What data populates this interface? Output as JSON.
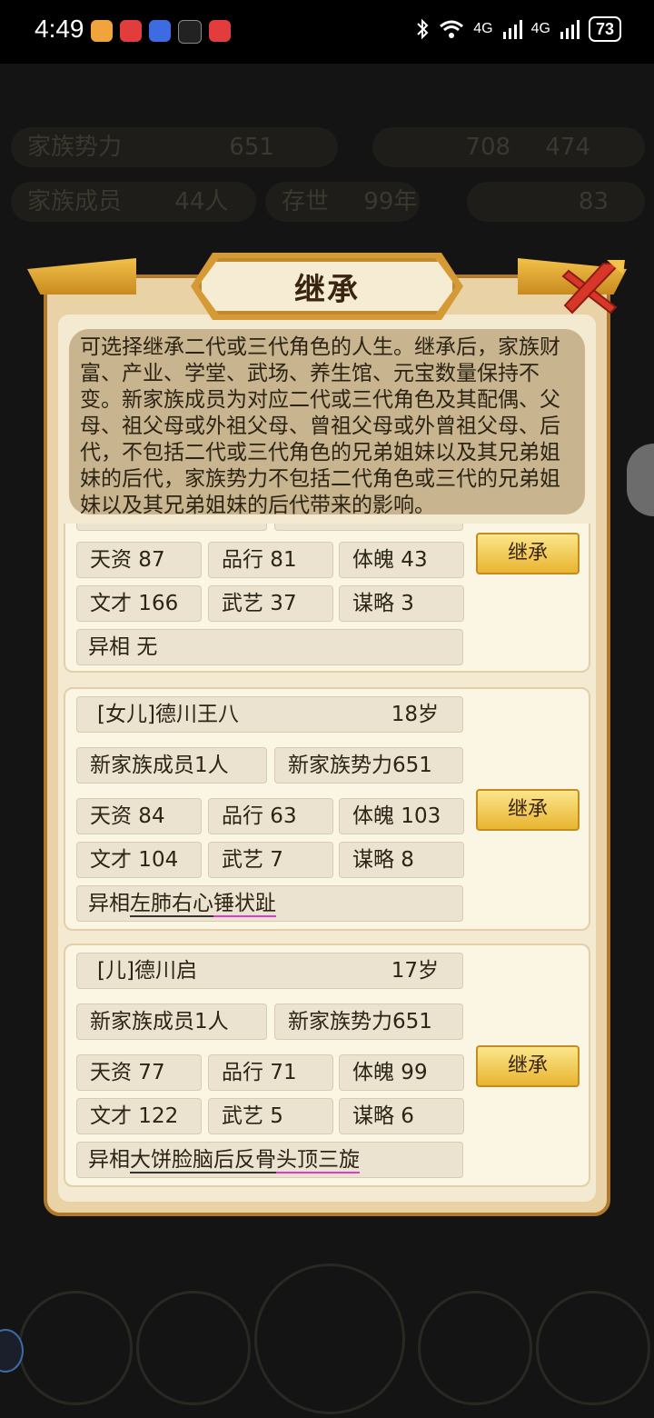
{
  "status_bar": {
    "time": "4:49",
    "battery": "73",
    "network_left": "4G",
    "network_right": "4G"
  },
  "modal": {
    "title": "继承",
    "description": "可选择继承二代或三代角色的人生。继承后，家族财富、产业、学堂、武场、养生馆、元宝数量保持不变。新家族成员为对应二代或三代角色及其配偶、父母、祖父母或外祖父母、曾祖父母或外曾祖父母、后代，不包括二代或三代角色的兄弟姐妹以及其兄弟姐妹的后代，家族势力不包括二代角色或三代的兄弟姐妹以及其兄弟姐妹的后代带来的影响。",
    "inherit_label": "继承"
  },
  "candidates": [
    {
      "stats": {
        "tianzi": "天资 87",
        "pinxing": "品行 81",
        "tipo": "体魄 43",
        "wencai": "文才 166",
        "wuyi": "武艺 37",
        "moulue": "谋略 3"
      },
      "yixiang_label": "异相",
      "yixiang_traits": [
        "无"
      ]
    },
    {
      "name": "[女儿]德川王八",
      "age": "18岁",
      "new_members": "新家族成员1人",
      "new_power": "新家族势力651",
      "stats": {
        "tianzi": "天资 84",
        "pinxing": "品行 63",
        "tipo": "体魄 103",
        "wencai": "文才 104",
        "wuyi": "武艺 7",
        "moulue": "谋略 8"
      },
      "yixiang_label": "异相",
      "yixiang_traits": [
        "左肺右心",
        "锤状趾"
      ]
    },
    {
      "name": "[儿]德川启",
      "age": "17岁",
      "new_members": "新家族成员1人",
      "new_power": "新家族势力651",
      "stats": {
        "tianzi": "天资 77",
        "pinxing": "品行 71",
        "tipo": "体魄 99",
        "wencai": "文才 122",
        "wuyi": "武艺 5",
        "moulue": "谋略 6"
      },
      "yixiang_label": "异相",
      "yixiang_traits": [
        "大饼脸",
        "脑后反骨",
        "头顶三旋"
      ]
    }
  ],
  "background": {
    "family_power_label": "家族势力",
    "family_power_value": "651",
    "family_members_label": "家族成员",
    "family_members_value": "44人",
    "alive_label": "存世",
    "alive_value": "99年",
    "coins": "708",
    "silver": "474",
    "gems": "83"
  }
}
